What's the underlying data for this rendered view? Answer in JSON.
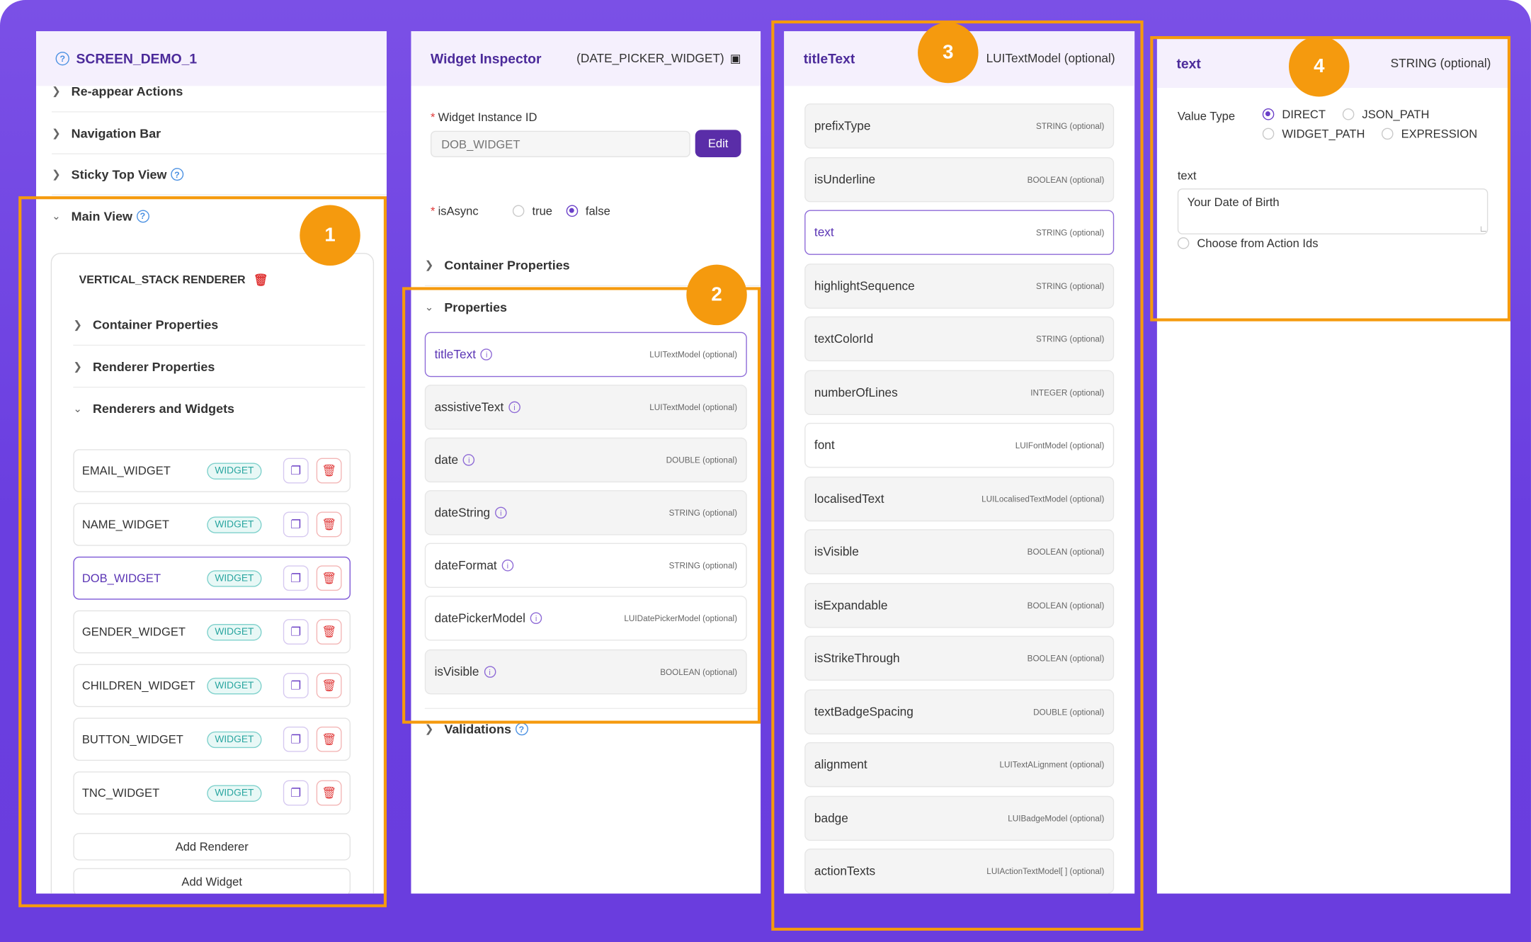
{
  "panel1": {
    "title": "SCREEN_DEMO_1",
    "rows": [
      "Re-appear Actions",
      "Navigation Bar",
      "Sticky Top View"
    ],
    "main_view": "Main View",
    "renderer_title": "VERTICAL_STACK RENDERER",
    "sub_rows": [
      "Container Properties",
      "Renderer Properties",
      "Renderers and Widgets"
    ],
    "widgets": [
      {
        "name": "EMAIL_WIDGET",
        "tag": "WIDGET"
      },
      {
        "name": "NAME_WIDGET",
        "tag": "WIDGET"
      },
      {
        "name": "DOB_WIDGET",
        "tag": "WIDGET"
      },
      {
        "name": "GENDER_WIDGET",
        "tag": "WIDGET"
      },
      {
        "name": "CHILDREN_WIDGET",
        "tag": "WIDGET"
      },
      {
        "name": "BUTTON_WIDGET",
        "tag": "WIDGET"
      },
      {
        "name": "TNC_WIDGET",
        "tag": "WIDGET"
      }
    ],
    "add_renderer": "Add Renderer",
    "add_widget": "Add Widget"
  },
  "panel2": {
    "title": "Widget Inspector",
    "right": "(DATE_PICKER_WIDGET)",
    "instance_label": "Widget Instance ID",
    "instance_placeholder": "DOB_WIDGET",
    "edit": "Edit",
    "is_async": "isAsync",
    "true_label": "true",
    "false_label": "false",
    "container_props": "Container Properties",
    "properties": "Properties",
    "props": [
      {
        "name": "titleText",
        "type": "LUITextModel (optional)"
      },
      {
        "name": "assistiveText",
        "type": "LUITextModel (optional)"
      },
      {
        "name": "date",
        "type": "DOUBLE (optional)"
      },
      {
        "name": "dateString",
        "type": "STRING (optional)"
      },
      {
        "name": "dateFormat",
        "type": "STRING (optional)"
      },
      {
        "name": "datePickerModel",
        "type": "LUIDatePickerModel (optional)"
      },
      {
        "name": "isVisible",
        "type": "BOOLEAN (optional)"
      }
    ],
    "validations": "Validations"
  },
  "panel3": {
    "title": "titleText",
    "right": "LUITextModel (optional)",
    "props": [
      {
        "name": "prefixType",
        "type": "STRING (optional)"
      },
      {
        "name": "isUnderline",
        "type": "BOOLEAN (optional)"
      },
      {
        "name": "text",
        "type": "STRING (optional)"
      },
      {
        "name": "highlightSequence",
        "type": "STRING (optional)"
      },
      {
        "name": "textColorId",
        "type": "STRING (optional)"
      },
      {
        "name": "numberOfLines",
        "type": "INTEGER (optional)"
      },
      {
        "name": "font",
        "type": "LUIFontModel (optional)"
      },
      {
        "name": "localisedText",
        "type": "LUILocalisedTextModel (optional)"
      },
      {
        "name": "isVisible",
        "type": "BOOLEAN (optional)"
      },
      {
        "name": "isExpandable",
        "type": "BOOLEAN (optional)"
      },
      {
        "name": "isStrikeThrough",
        "type": "BOOLEAN (optional)"
      },
      {
        "name": "textBadgeSpacing",
        "type": "DOUBLE (optional)"
      },
      {
        "name": "alignment",
        "type": "LUITextALignment (optional)"
      },
      {
        "name": "badge",
        "type": "LUIBadgeModel (optional)"
      },
      {
        "name": "actionTexts",
        "type": "LUIActionTextModel[ ] (optional)"
      }
    ]
  },
  "panel4": {
    "title": "text",
    "right": "STRING (optional)",
    "value_type": "Value Type",
    "opt_direct": "DIRECT",
    "opt_json": "JSON_PATH",
    "opt_widget": "WIDGET_PATH",
    "opt_expr": "EXPRESSION",
    "text_label": "text",
    "text_value": "Your Date of Birth",
    "choose": "Choose from Action Ids"
  },
  "badges": [
    "1",
    "2",
    "3",
    "4"
  ],
  "colors": {
    "accent": "#4b2a9a",
    "highlight": "#f59a0e",
    "bg": "#6a3ee0"
  }
}
